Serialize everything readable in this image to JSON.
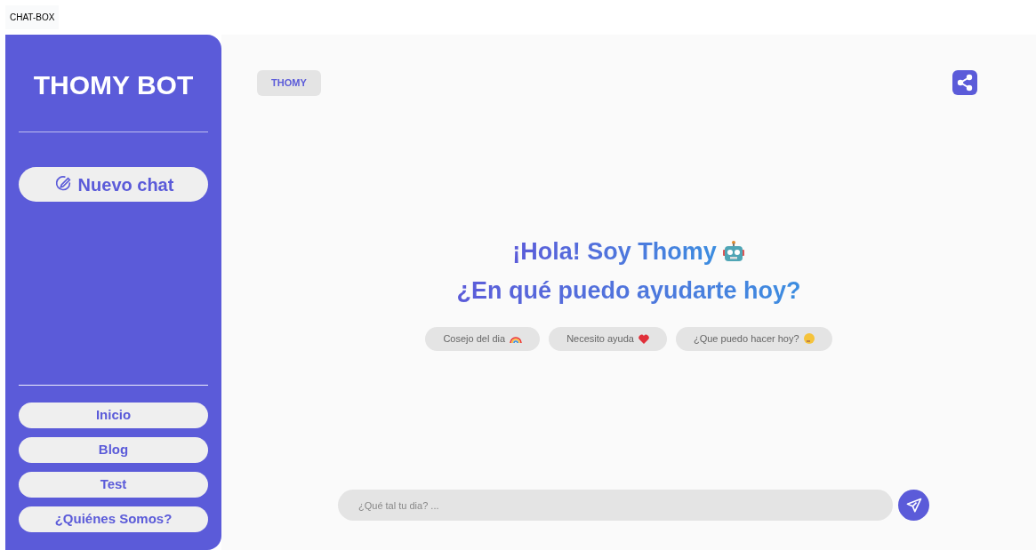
{
  "window": {
    "title": "CHAT-BOX"
  },
  "sidebar": {
    "title": "THOMY BOT",
    "new_chat": "Nuevo chat",
    "nav": [
      {
        "label": "Inicio"
      },
      {
        "label": "Blog"
      },
      {
        "label": "Test"
      },
      {
        "label": "¿Quiénes Somos?"
      }
    ]
  },
  "header": {
    "badge": "THOMY"
  },
  "greeting": [
    "¡Hola! Soy Thomy",
    "¿En qué puedo ayudarte hoy?"
  ],
  "suggestions": [
    {
      "label": "Cosejo del dia",
      "kind": "rainbow"
    },
    {
      "label": "Necesito ayuda",
      "kind": "heart"
    },
    {
      "label": "¿Que puedo hacer hoy?",
      "kind": "thinking"
    }
  ],
  "composer": {
    "placeholder": "¿Qué tal tu dia? ..."
  }
}
